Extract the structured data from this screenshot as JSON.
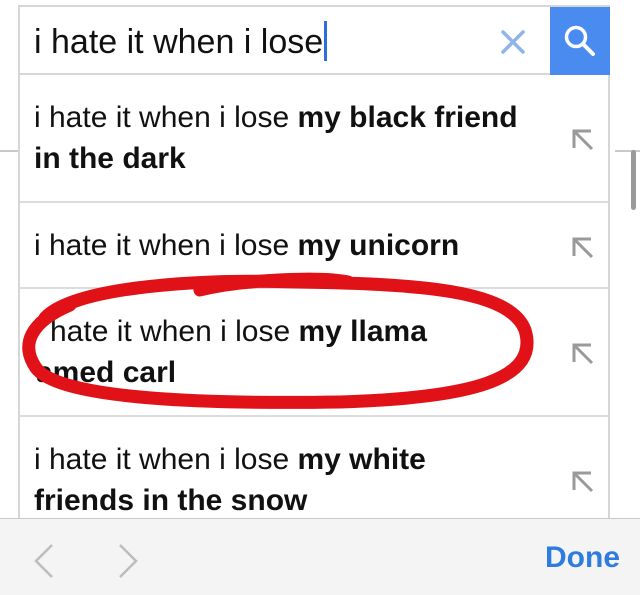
{
  "search": {
    "query": "i hate it when i lose"
  },
  "suggestions": [
    {
      "base": "i hate it when i lose ",
      "bold": "my black friend in the dark"
    },
    {
      "base": "i hate it when i lose ",
      "bold": "my unicorn"
    },
    {
      "base": "hate it when i lose ",
      "bold": "my llama",
      "bold2": "amed carl"
    },
    {
      "base": "i hate it when i lose ",
      "bold": "my white friends in the snow"
    }
  ],
  "toolbar": {
    "done_label": "Done"
  },
  "colors": {
    "accent": "#4a8bf0",
    "link": "#2f7ce0",
    "annotation": "#e01218"
  },
  "icons": {
    "clear": "close-icon",
    "search": "search-icon",
    "fill": "arrow-up-left-icon",
    "prev": "chevron-left-icon",
    "next": "chevron-right-icon"
  }
}
